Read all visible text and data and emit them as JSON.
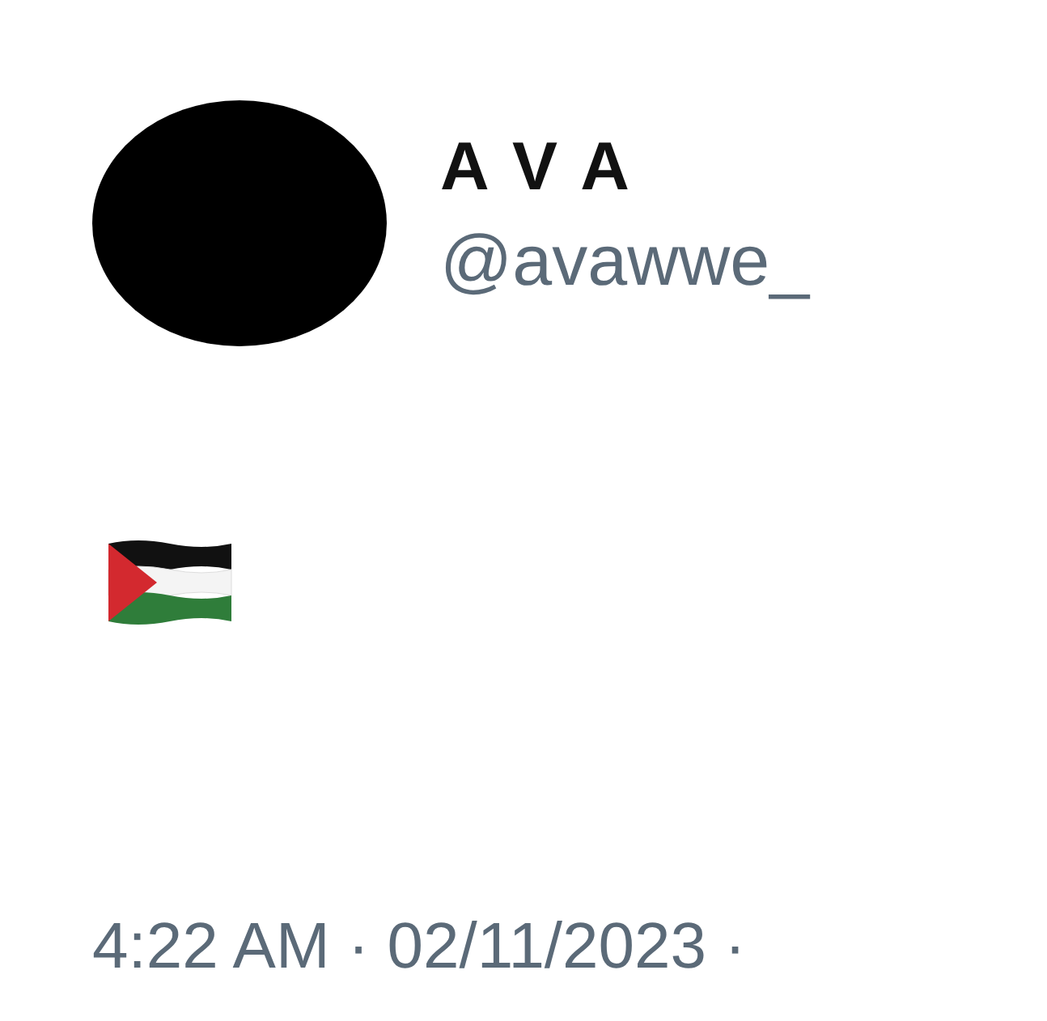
{
  "author": {
    "name": "A V A",
    "handle": "@avawwe_"
  },
  "timestamp": "4:22 AM · 02/11/2023 ·"
}
